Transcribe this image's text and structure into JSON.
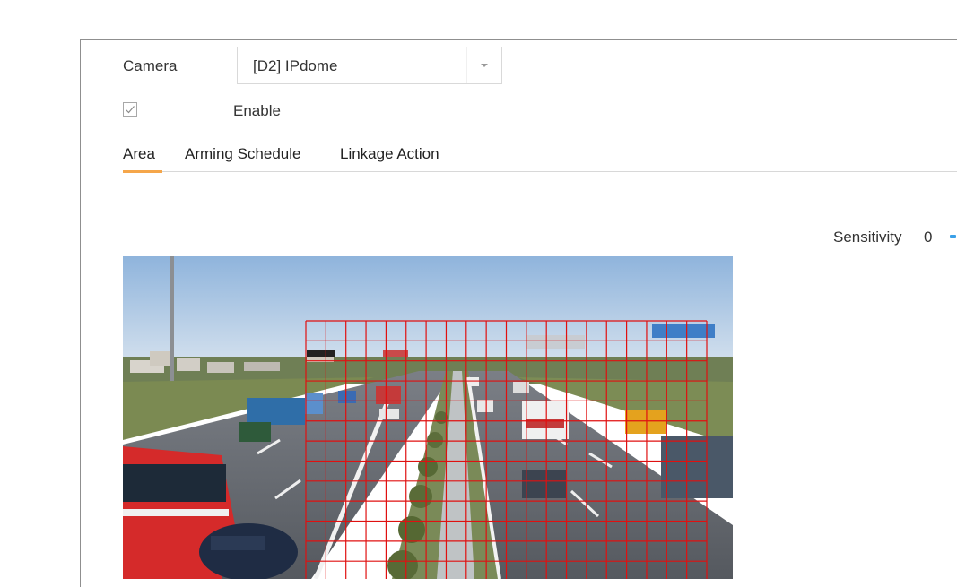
{
  "camera": {
    "label": "Camera",
    "selected": "[D2] IPdome"
  },
  "enable": {
    "label": "Enable",
    "checked": true
  },
  "tabs": [
    {
      "label": "Area",
      "active": true
    },
    {
      "label": "Arming Schedule",
      "active": false
    },
    {
      "label": "Linkage Action",
      "active": false
    }
  ],
  "sensitivity": {
    "label": "Sensitivity",
    "value": "0"
  },
  "colors": {
    "accent_tab": "#f5a64a",
    "slider": "#3aa0e8",
    "grid": "#e01010"
  },
  "icons": {
    "checkbox": "checkmark-icon",
    "dropdown": "chevron-down-icon"
  }
}
